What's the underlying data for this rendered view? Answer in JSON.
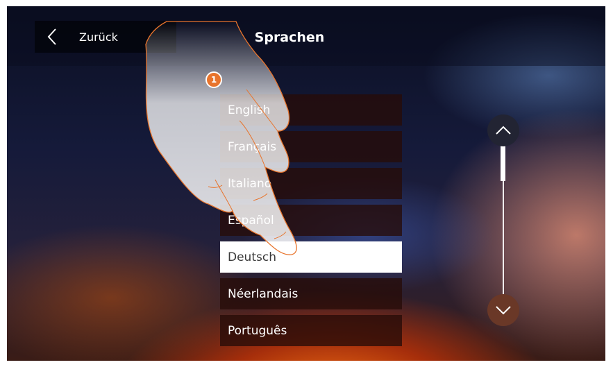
{
  "header": {
    "back_label": "Zurück",
    "title": "Sprachen"
  },
  "languages": [
    {
      "label": "English",
      "selected": false
    },
    {
      "label": "Français",
      "selected": false
    },
    {
      "label": "Italiano",
      "selected": false
    },
    {
      "label": "Español",
      "selected": false
    },
    {
      "label": "Deutsch",
      "selected": true
    },
    {
      "label": "Néerlandais",
      "selected": false
    },
    {
      "label": "Português",
      "selected": false
    }
  ],
  "tutorial": {
    "step_number": "1"
  },
  "icons": {
    "back": "chevron-left-icon",
    "scroll_up": "chevron-up-icon",
    "scroll_down": "chevron-down-icon"
  },
  "colors": {
    "accent": "#e8742c",
    "selected_bg": "#ffffff",
    "item_bg": "#260c08"
  }
}
